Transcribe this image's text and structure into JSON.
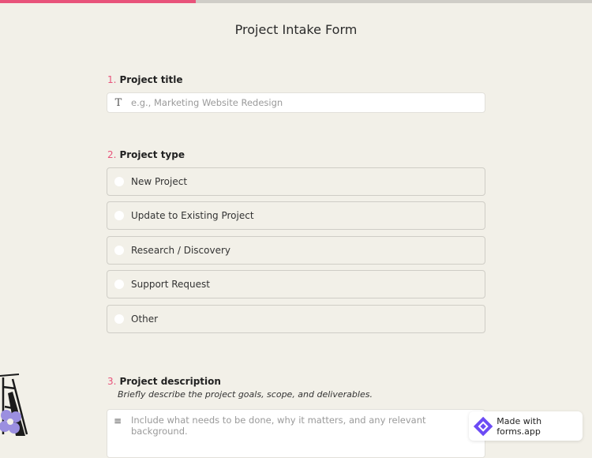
{
  "progress": {
    "fraction": 0.33
  },
  "form": {
    "title": "Project Intake Form"
  },
  "questions": {
    "q1": {
      "number": "1.",
      "label": "Project title",
      "icon": "text-type-icon",
      "placeholder": "e.g., Marketing Website Redesign"
    },
    "q2": {
      "number": "2.",
      "label": "Project type",
      "options": [
        "New Project",
        "Update to Existing Project",
        "Research / Discovery",
        "Support Request",
        "Other"
      ]
    },
    "q3": {
      "number": "3.",
      "label": "Project description",
      "help": "Briefly describe the project goals, scope, and deliverables.",
      "icon": "paragraph-icon",
      "placeholder": "Include what needs to be done, why it matters, and any relevant background."
    }
  },
  "badge": {
    "text": "Made with forms.app"
  },
  "colors": {
    "accent": "#e8537a",
    "background": "#f2f0e8",
    "badge_logo": "#6c4bf5"
  }
}
